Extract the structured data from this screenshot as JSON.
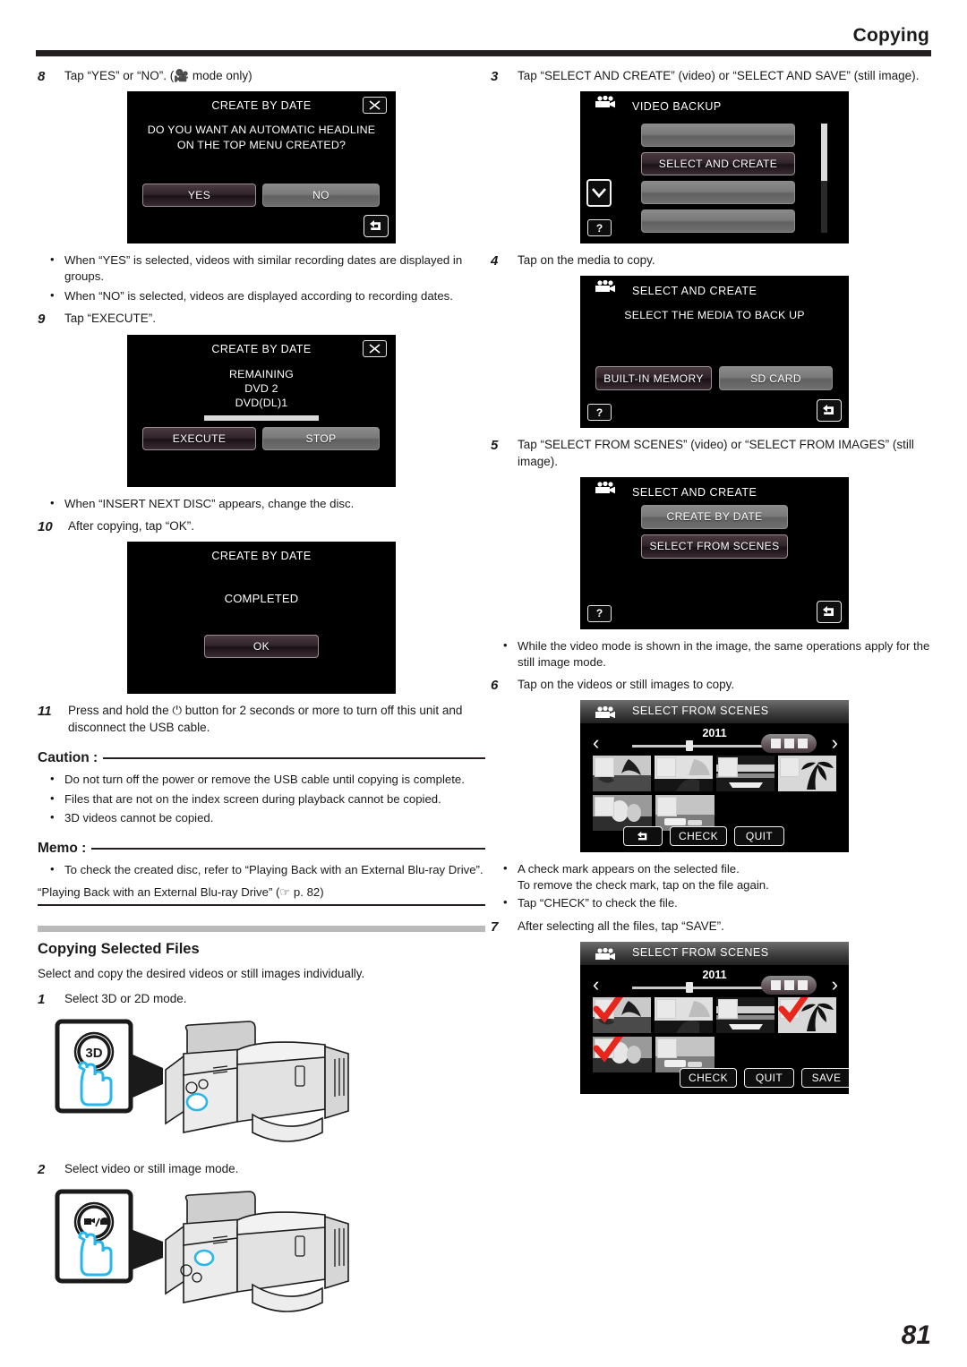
{
  "header": {
    "title": "Copying",
    "page_number": "81"
  },
  "left": {
    "step8": {
      "num": "8",
      "text": "Tap “YES” or “NO”. (🎥 mode only)"
    },
    "screen_yesno": {
      "title": "CREATE BY DATE",
      "message": "DO YOU WANT AN AUTOMATIC HEADLINE ON THE TOP MENU CREATED?",
      "yes_label": "YES",
      "no_label": "NO",
      "close_icon": "close-x-icon",
      "return_icon": "return-arrow-icon"
    },
    "bullets_after_8": [
      "When “YES” is selected, videos with similar recording dates are displayed in groups.",
      "When “NO” is selected, videos are displayed according to recording dates."
    ],
    "step9": {
      "num": "9",
      "text": "Tap “EXECUTE”."
    },
    "screen_execute": {
      "title": "CREATE BY DATE",
      "line1": "REMAINING",
      "line2": "DVD   2",
      "line3": "DVD(DL)1",
      "execute_label": "EXECUTE",
      "stop_label": "STOP"
    },
    "bullet_after_9": "When “INSERT NEXT DISC” appears, change the disc.",
    "step10": {
      "num": "10",
      "text": "After copying, tap “OK”."
    },
    "screen_completed": {
      "title": "CREATE BY DATE",
      "message": "COMPLETED",
      "ok_label": "OK"
    },
    "step11": {
      "num": "11",
      "text": "Press and hold the ⏻ button for 2 seconds or more to turn off this unit and disconnect the USB cable."
    },
    "caution": {
      "label": "Caution :",
      "items": [
        "Do not turn off the power or remove the USB cable until copying is complete.",
        "Files that are not on the index screen during playback cannot be copied.",
        "3D videos cannot be copied."
      ]
    },
    "memo": {
      "label": "Memo :",
      "items": [
        "To check the created disc, refer to “Playing Back with an External Blu-ray Drive”."
      ],
      "reference": "“Playing Back with an External Blu-ray Drive” (☞ p. 82)"
    },
    "section": {
      "title": "Copying Selected Files",
      "lead": "Select and copy the desired videos or still images individually."
    },
    "step1": {
      "num": "1",
      "text": "Select 3D or 2D mode."
    },
    "fig_3d": {
      "button_label": "3D",
      "alt": "camcorder-3d-button-illustration"
    },
    "step2": {
      "num": "2",
      "text": "Select video or still image mode."
    },
    "fig_mode": {
      "button_label": "■/□",
      "alt": "camcorder-video-still-mode-button-illustration"
    }
  },
  "right": {
    "step3": {
      "num": "3",
      "text": "Tap “SELECT AND CREATE” (video) or “SELECT AND SAVE” (still image)."
    },
    "screen_video_backup": {
      "title": "VIDEO BACKUP",
      "selected_item": "SELECT AND CREATE",
      "blank_items": [
        "",
        "",
        ""
      ],
      "down_icon": "chevron-down-icon",
      "help_icon": "help-question-icon"
    },
    "step4": {
      "num": "4",
      "text": "Tap on the media to copy."
    },
    "screen_media": {
      "title": "SELECT AND CREATE",
      "message": "SELECT THE MEDIA TO BACK UP",
      "builtin_label": "BUILT-IN MEMORY",
      "sdcard_label": "SD CARD"
    },
    "step5": {
      "num": "5",
      "text": "Tap “SELECT FROM SCENES” (video) or “SELECT FROM IMAGES” (still image)."
    },
    "screen_select_create": {
      "title": "SELECT AND CREATE",
      "item1": "CREATE BY DATE",
      "item2": "SELECT FROM SCENES"
    },
    "bullet_after_5": "While the video mode is shown in the image, the same operations apply for the still image mode.",
    "step6": {
      "num": "6",
      "text": "Tap on the videos or still images to copy."
    },
    "screen_scenes_unchecked": {
      "title": "SELECT FROM SCENES",
      "year": "2011",
      "back_label": "↩",
      "check_label": "CHECK",
      "quit_label": "QUIT",
      "checked": [
        false,
        false,
        false,
        false,
        false,
        false
      ]
    },
    "bullets_after_6": [
      "A check mark appears on the selected file.\nTo remove the check mark, tap on the file again.",
      "Tap “CHECK” to check the file."
    ],
    "step7": {
      "num": "7",
      "text": "After selecting all the files, tap “SAVE”."
    },
    "screen_scenes_checked": {
      "title": "SELECT FROM SCENES",
      "year": "2011",
      "check_label": "CHECK",
      "quit_label": "QUIT",
      "save_label": "SAVE",
      "checked": [
        true,
        false,
        false,
        true,
        true,
        false
      ]
    }
  },
  "colors": {
    "page_bg": "#ffffff",
    "text": "#1a1a1a",
    "rule": "#231f20",
    "section_bar": "#b9b9b9",
    "lcd_bg": "#000000",
    "check_red": "#e8261c",
    "accent_cyan": "#29b6e8"
  }
}
